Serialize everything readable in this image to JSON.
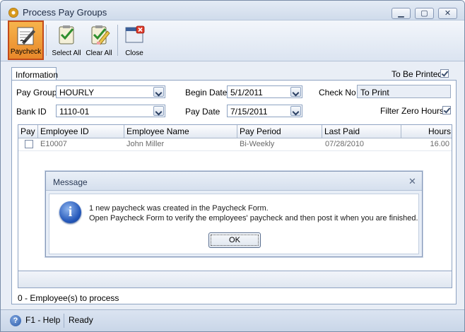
{
  "window": {
    "title": "Process Pay Groups"
  },
  "toolbar": {
    "paycheck_label": "Paycheck",
    "select_all_label": "Select All",
    "clear_all_label": "Clear All",
    "close_label": "Close"
  },
  "tabs": [
    {
      "label": "Information"
    }
  ],
  "form": {
    "to_be_printed_label": "To Be Printed",
    "to_be_printed_checked": true,
    "pay_group_label": "Pay Group",
    "pay_group_value": "HOURLY",
    "begin_date_label": "Begin Date",
    "begin_date_value": "5/1/2011",
    "check_no_label": "Check No",
    "check_no_value": "To Print",
    "bank_id_label": "Bank ID",
    "bank_id_value": "1110-01",
    "pay_date_label": "Pay Date",
    "pay_date_value": "7/15/2011",
    "filter_zero_hours_label": "Filter Zero Hours",
    "filter_zero_hours_checked": true
  },
  "grid": {
    "columns": [
      "Pay",
      "Employee ID",
      "Employee Name",
      "Pay Period",
      "Last Paid",
      "Hours"
    ],
    "rows": [
      {
        "pay": false,
        "employee_id": "E10007",
        "employee_name": "John Miller",
        "pay_period": "Bi-Weekly",
        "last_paid": "07/28/2010",
        "hours": "16.00"
      }
    ]
  },
  "footer": {
    "process_text": "0 -  Employee(s) to process"
  },
  "statusbar": {
    "help": "F1 - Help",
    "status": "Ready"
  },
  "dialog": {
    "title": "Message",
    "line1": "1 new paycheck was created in the Paycheck Form.",
    "line2": "Open Paycheck Form to verify the employees' paycheck and then post it when you are finished.",
    "ok_label": "OK"
  },
  "colors": {
    "active_button": "#e8882a",
    "window_bg": "#e9eef6",
    "border": "#8ea3c2"
  }
}
